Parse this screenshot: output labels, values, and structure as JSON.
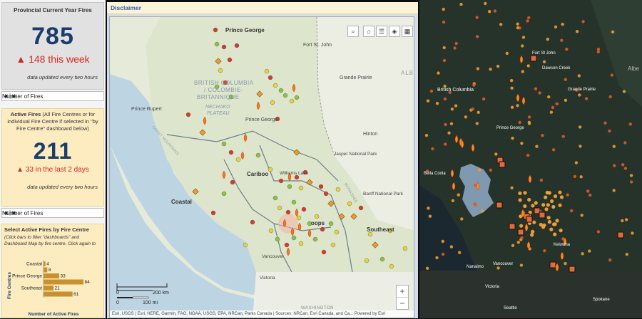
{
  "provincial": {
    "title": "Provincial Current Year Fires",
    "total": "785",
    "weekly": "148 this week",
    "updated": "data updated every two hours"
  },
  "selector1": {
    "label": "Number of Fires"
  },
  "active": {
    "title_bold": "Active Fires",
    "title_rest": " (All Fire Centres or for individual Fire Centre if selected in \"by Fire Centre\" dashboard below)",
    "total": "211",
    "recent": "33 in the last 2 days",
    "updated": "data updated every two hours"
  },
  "selector2": {
    "label": "Number of Fires"
  },
  "by_centre": {
    "title": "Select Active Fires by Fire Centre",
    "instructions": "(Click bars to filter \"dashboards\" and Dashboard Map by fire centre.  Click again to",
    "ylabel": "Fire Centres",
    "xlabel": "Number of Active Fires"
  },
  "chart_data": {
    "type": "bar",
    "orientation": "horizontal",
    "categories": [
      "Coastal",
      "",
      "Prince George",
      "",
      "Southeast",
      ""
    ],
    "values": [
      4,
      8,
      33,
      84,
      21,
      61
    ],
    "xlabel": "Number of Active Fires",
    "ylabel": "Fire Centres",
    "bar_color": "#c8912e"
  },
  "header": {
    "disclaimer": "Disclaimer"
  },
  "map_labels": {
    "prince_george": "Prince George",
    "fort_st_john": "Fort St. John",
    "grande_prairie": "Grande Prairie",
    "alberta": "ALBE",
    "bc_line1": "BRITISH COLUMBIA",
    "bc_line2": "/ COLOMBIE-",
    "bc_line3": "BRITANNIQUE",
    "nechako1": "NECHAKO",
    "nechako2": "PLATEAU",
    "prince_rupert": "Prince Rupert",
    "prince_george2": "Prince George",
    "hinton": "Hinton",
    "jasper": "Jasper National Park",
    "cariboo": "Cariboo",
    "williams_lake": "Williams Lake",
    "banff": "Banff National Park",
    "coastal": "Coastal",
    "kamloops": "oops",
    "southeast": "Southeast",
    "vancouver": "Vancouver",
    "victoria": "Victoria",
    "washington": "WASHINGTON",
    "coast_mountains": "COAST MOUNTAINS",
    "monashee": "MONASHEE"
  },
  "scale": {
    "km": "200 km",
    "mi": "100 mi",
    "zero1": "0",
    "zero2": "0"
  },
  "attribution": "Esri, USGS | Esri, HERE, Garmin, FAO, NOAA, USGS, EPA, NRCan, Parks Canada | Sources: NRCan, Esri Canada, and Ca...    Powered by Esri",
  "right_labels": {
    "fort_st_john": "Fort St John",
    "dawson_creek": "Dawson Creek",
    "grande_prairie": "Grande Prairie",
    "british_columbia": "British Columbia",
    "prince_george": "Prince George",
    "bella_coola": "Bella Coola",
    "vancouver": "Vancouver",
    "nanaimo": "Nanaimo",
    "victoria": "Victoria",
    "seattle": "Seattle",
    "spokane": "Spokane",
    "kelowna": "Kelowna",
    "alberta": "Albe"
  },
  "colors": {
    "accent_blue": "#1c3d6b",
    "alert_red": "#d9281f",
    "panel_yellow": "#fcecc0"
  }
}
